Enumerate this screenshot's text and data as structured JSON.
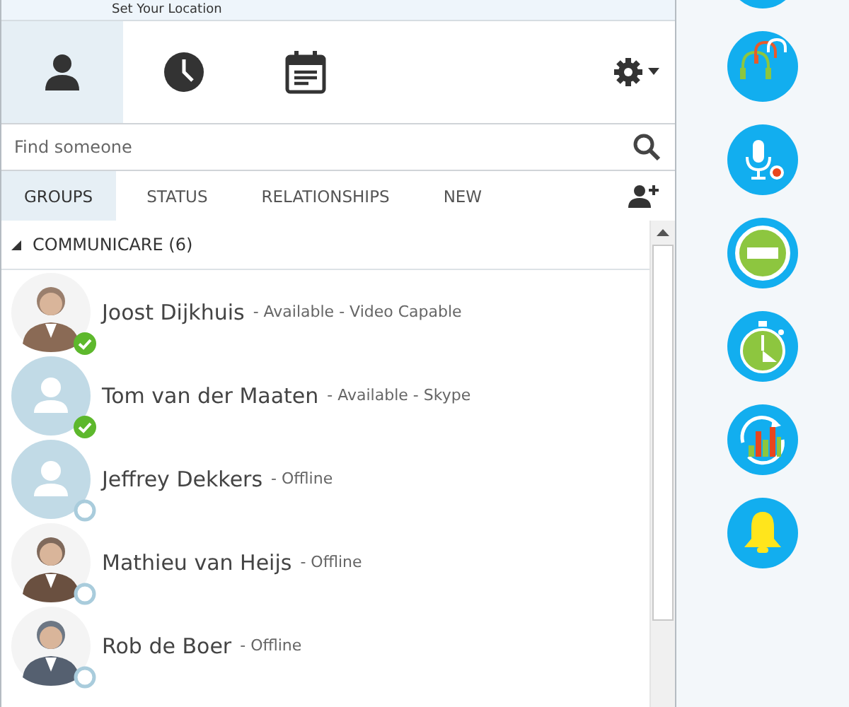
{
  "header": {
    "text": "Set Your Location"
  },
  "toolbar": {
    "tabs": [
      {
        "kind": "person",
        "selected": true
      },
      {
        "kind": "clock",
        "selected": false
      },
      {
        "kind": "calendar",
        "selected": false
      }
    ]
  },
  "search": {
    "placeholder": "Find someone"
  },
  "filter_tabs": [
    {
      "label": "GROUPS",
      "selected": true
    },
    {
      "label": "STATUS",
      "selected": false
    },
    {
      "label": "RELATIONSHIPS",
      "selected": false
    },
    {
      "label": "NEW",
      "selected": false
    }
  ],
  "group": {
    "name": "COMMUNICARE (6)",
    "expanded": true
  },
  "contacts": [
    {
      "name": "Joost Dijkhuis",
      "status": "- Available - Video Capable",
      "available": true,
      "has_photo": true
    },
    {
      "name": "Tom van der Maaten",
      "status": "- Available - Skype",
      "available": true,
      "has_photo": false
    },
    {
      "name": "Jeffrey Dekkers",
      "status": "- Offline",
      "available": false,
      "has_photo": false
    },
    {
      "name": "Mathieu van Heijs",
      "status": "- Offline",
      "available": false,
      "has_photo": true
    },
    {
      "name": "Rob de Boer",
      "status": "- Offline",
      "available": false,
      "has_photo": true
    }
  ]
}
